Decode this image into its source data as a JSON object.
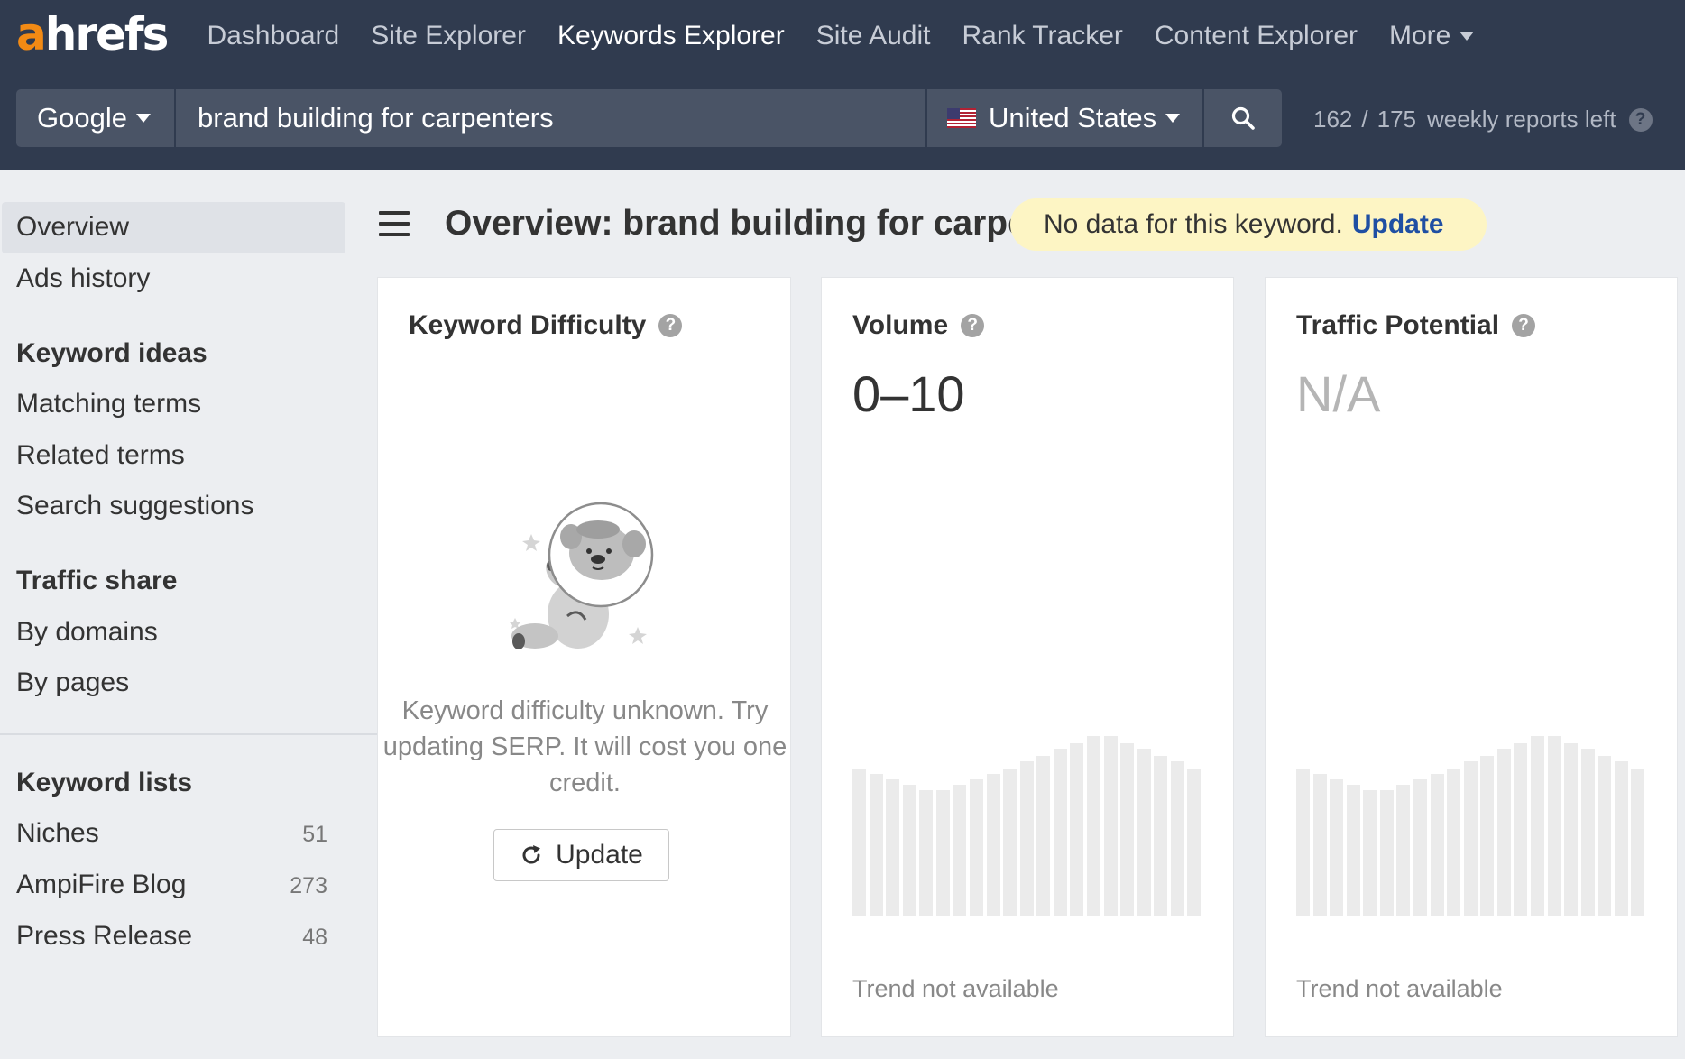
{
  "nav": {
    "logo_a": "a",
    "logo_rest": "hrefs",
    "items": [
      "Dashboard",
      "Site Explorer",
      "Keywords Explorer",
      "Site Audit",
      "Rank Tracker",
      "Content Explorer"
    ],
    "more": "More",
    "active": "Keywords Explorer"
  },
  "search": {
    "engine": "Google",
    "keyword": "brand building for carpenters",
    "country": "United States",
    "reports_used": "162",
    "reports_sep": "/",
    "reports_total": "175",
    "reports_label": "weekly reports left"
  },
  "sidebar": {
    "overview": "Overview",
    "ads_history": "Ads history",
    "keyword_ideas": {
      "heading": "Keyword ideas",
      "items": [
        "Matching terms",
        "Related terms",
        "Search suggestions"
      ]
    },
    "traffic_share": {
      "heading": "Traffic share",
      "items": [
        "By domains",
        "By pages"
      ]
    },
    "keyword_lists": {
      "heading": "Keyword lists",
      "items": [
        {
          "label": "Niches",
          "count": "51"
        },
        {
          "label": "AmpiFire Blog",
          "count": "273"
        },
        {
          "label": "Press Release",
          "count": "48"
        }
      ]
    }
  },
  "main": {
    "title": "Overview: brand building for carpenters",
    "notice_text": "No data for this keyword.",
    "notice_link": "Update",
    "cards": {
      "kd": {
        "title": "Keyword Difficulty",
        "message": "Keyword difficulty unknown. Try updating SERP. It will cost you one credit.",
        "button": "Update"
      },
      "volume": {
        "title": "Volume",
        "value": "0–10",
        "trend_note": "Trend not available"
      },
      "traffic": {
        "title": "Traffic Potential",
        "value": "N/A",
        "trend_note": "Trend not available"
      }
    }
  },
  "colors": {
    "nav_bg": "#303b4f",
    "input_bg": "#4a5466",
    "brand_orange": "#f28a14",
    "notice_bg": "#fdf5c4",
    "link_blue": "#1f4fa3",
    "placeholder_bar": "#ebebeb"
  },
  "icons": [
    "caret-down-icon",
    "us-flag-icon",
    "search-icon",
    "help-icon",
    "hamburger-menu-icon",
    "refresh-icon",
    "astronaut-koala-illustration"
  ],
  "trend_placeholder_levels": [
    0.82,
    0.79,
    0.76,
    0.73,
    0.7,
    0.7,
    0.73,
    0.76,
    0.79,
    0.82,
    0.86,
    0.89,
    0.93,
    0.96,
    1.0,
    1.0,
    0.96,
    0.93,
    0.89,
    0.86,
    0.82
  ]
}
